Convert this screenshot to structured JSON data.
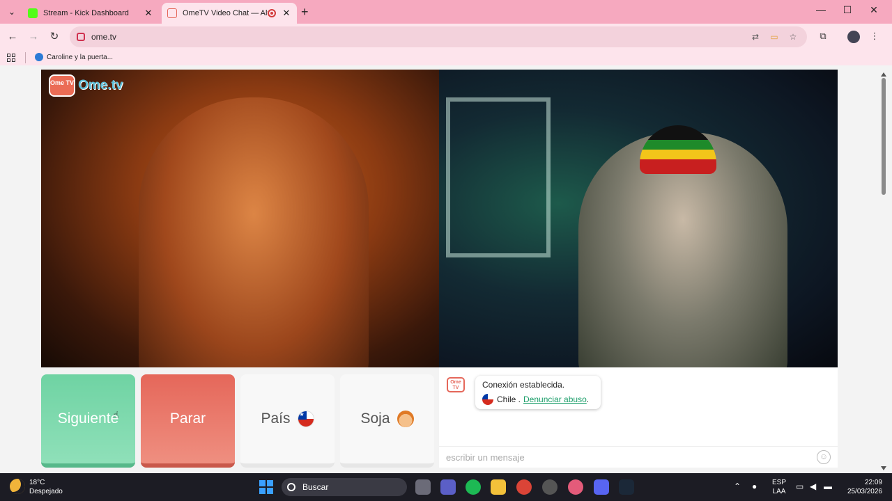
{
  "browser": {
    "tabs": [
      {
        "title": "Stream - Kick Dashboard",
        "favicon_color": "#53fc18"
      },
      {
        "title": "OmeTV Video Chat — Alter",
        "favicon_color": "#e5675a"
      }
    ],
    "url": "ome.tv",
    "bookmark": "Caroline y la puerta..."
  },
  "page": {
    "logo_tv": "Ome TV",
    "logo_name": "Ome.tv",
    "buttons": {
      "next": "Siguiente",
      "stop": "Parar",
      "country": "País",
      "gender": "Soja"
    },
    "chat": {
      "avatar": "Ome TV",
      "message": "Conexión establecida.",
      "country": "Chile .",
      "report": "Denunciar abuso",
      "report_suffix": ".",
      "input_placeholder": "escribir un mensaje"
    }
  },
  "taskbar": {
    "temperature": "18°C",
    "condition": "Despejado",
    "search": "Buscar",
    "lang": "ESP",
    "layout": "LAA",
    "time": "22:09",
    "date": "25/03/2026"
  },
  "colors": {
    "accent_pink": "#f6a9bf",
    "next_green": "#6fd3a3",
    "stop_red": "#e5675a",
    "link_green": "#1c9e6a"
  }
}
